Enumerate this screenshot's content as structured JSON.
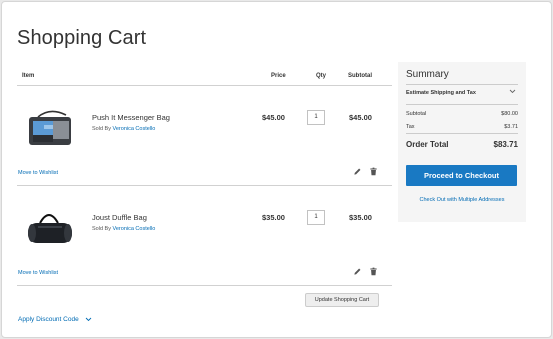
{
  "page": {
    "title": "Shopping Cart"
  },
  "cart": {
    "headers": {
      "item": "Item",
      "price": "Price",
      "qty": "Qty",
      "subtotal": "Subtotal"
    },
    "items": [
      {
        "name": "Push It Messenger Bag",
        "sold_by_prefix": "Sold By",
        "seller": "Veronica Costello",
        "price": "$45.00",
        "qty": "1",
        "subtotal": "$45.00",
        "wishlist_label": "Move to Wishlist",
        "image_icon": "messenger-bag-image"
      },
      {
        "name": "Joust Duffle Bag",
        "sold_by_prefix": "Sold By",
        "seller": "Veronica Costello",
        "price": "$35.00",
        "qty": "1",
        "subtotal": "$35.00",
        "wishlist_label": "Move to Wishlist",
        "image_icon": "duffle-bag-image"
      }
    ],
    "update_label": "Update Shopping Cart",
    "discount_label": "Apply Discount Code"
  },
  "summary": {
    "title": "Summary",
    "estimate_label": "Estimate Shipping and Tax",
    "subtotal_label": "Subtotal",
    "subtotal_value": "$80.00",
    "tax_label": "Tax",
    "tax_value": "$3.71",
    "order_total_label": "Order Total",
    "order_total_value": "$83.71",
    "checkout_label": "Proceed to Checkout",
    "multi_address_label": "Check Out with Multiple Addresses"
  },
  "colors": {
    "accent": "#1979c3",
    "link": "#006bb4",
    "summary_bg": "#f5f5f5"
  }
}
